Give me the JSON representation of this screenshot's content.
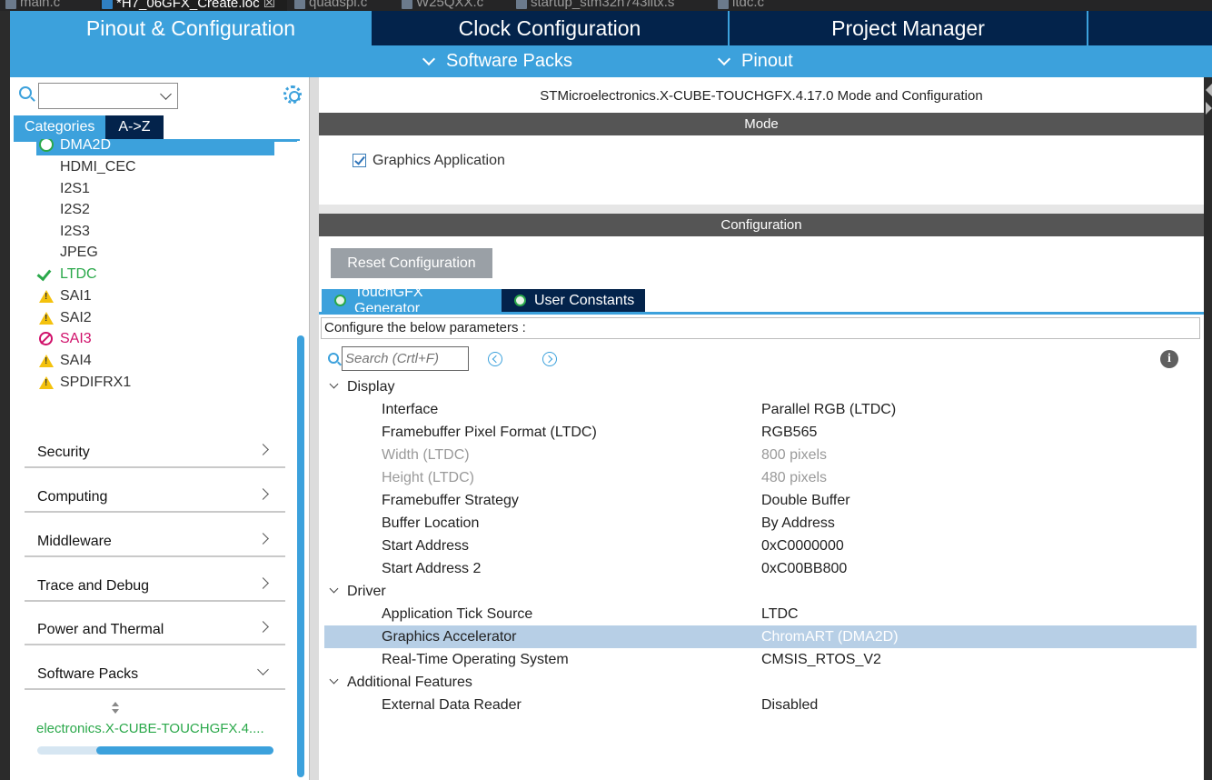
{
  "editor_tabs": [
    {
      "label": "main.c",
      "active": false
    },
    {
      "label": "*H7_06GFX_Create.ioc",
      "active": true
    },
    {
      "label": "quadspi.c",
      "active": false
    },
    {
      "label": "W25QXX.c",
      "active": false
    },
    {
      "label": "startup_stm32h743iitx.s",
      "active": false
    },
    {
      "label": "ltdc.c",
      "active": false
    }
  ],
  "close_glyph": "☒",
  "main_tabs": [
    "Pinout & Configuration",
    "Clock Configuration",
    "Project Manager"
  ],
  "sub_menu": {
    "software_packs": "Software Packs",
    "pinout": "Pinout"
  },
  "left": {
    "category_tabs": [
      "Categories",
      "A->Z"
    ],
    "peripherals": [
      {
        "label": "DMA2D",
        "status": "selected"
      },
      {
        "label": "HDMI_CEC",
        "status": "none"
      },
      {
        "label": "I2S1",
        "status": "none"
      },
      {
        "label": "I2S2",
        "status": "none"
      },
      {
        "label": "I2S3",
        "status": "none"
      },
      {
        "label": "JPEG",
        "status": "none"
      },
      {
        "label": "LTDC",
        "status": "ok"
      },
      {
        "label": "SAI1",
        "status": "warning"
      },
      {
        "label": "SAI2",
        "status": "warning"
      },
      {
        "label": "SAI3",
        "status": "error"
      },
      {
        "label": "SAI4",
        "status": "warning"
      },
      {
        "label": "SPDIFRX1",
        "status": "warning"
      }
    ],
    "categories": [
      {
        "label": "Security",
        "expanded": false
      },
      {
        "label": "Computing",
        "expanded": false
      },
      {
        "label": "Middleware",
        "expanded": false
      },
      {
        "label": "Trace and Debug",
        "expanded": false
      },
      {
        "label": "Power and Thermal",
        "expanded": false
      },
      {
        "label": "Software Packs",
        "expanded": true
      }
    ],
    "pack_item": "electronics.X-CUBE-TOUCHGFX.4....",
    "hscroll_fraction": 0.75
  },
  "right": {
    "title": "STMicroelectronics.X-CUBE-TOUCHGFX.4.17.0 Mode and Configuration",
    "mode_header": "Mode",
    "mode_checkbox_label": "Graphics Application",
    "mode_checkbox_checked": true,
    "config_header": "Configuration",
    "reset_button": "Reset Configuration",
    "tabs": [
      "TouchGFX Generator",
      "User Constants"
    ],
    "param_hint": "Configure the below parameters :",
    "search_placeholder": "Search (Crtl+F)",
    "info_glyph": "i",
    "groups": [
      {
        "name": "Display",
        "params": [
          {
            "name": "Interface",
            "value": "Parallel RGB (LTDC)",
            "dim": false
          },
          {
            "name": "Framebuffer Pixel Format (LTDC)",
            "value": "RGB565",
            "dim": false
          },
          {
            "name": "Width (LTDC)",
            "value": "800 pixels",
            "dim": true
          },
          {
            "name": "Height (LTDC)",
            "value": "480 pixels",
            "dim": true
          },
          {
            "name": "Framebuffer Strategy",
            "value": "Double Buffer",
            "dim": false
          },
          {
            "name": "Buffer Location",
            "value": "By Address",
            "dim": false
          },
          {
            "name": "Start Address",
            "value": "0xC0000000",
            "dim": false
          },
          {
            "name": "Start Address 2",
            "value": "0xC00BB800",
            "dim": false
          }
        ]
      },
      {
        "name": "Driver",
        "params": [
          {
            "name": "Application Tick Source",
            "value": "LTDC",
            "dim": false
          },
          {
            "name": "Graphics Accelerator",
            "value": "ChromART (DMA2D)",
            "dim": false,
            "selected": true
          },
          {
            "name": "Real-Time Operating System",
            "value": "CMSIS_RTOS_V2",
            "dim": false
          }
        ]
      },
      {
        "name": "Additional Features",
        "params": [
          {
            "name": "External Data Reader",
            "value": "Disabled",
            "dim": false
          }
        ]
      }
    ]
  }
}
